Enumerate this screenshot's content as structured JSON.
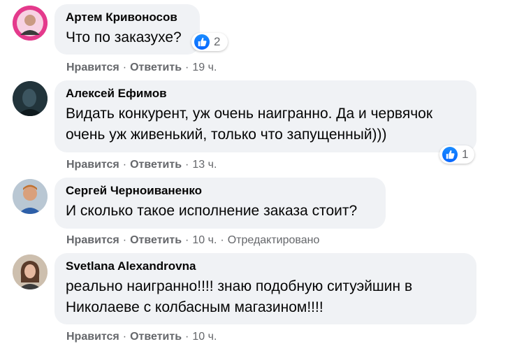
{
  "comments": [
    {
      "author": "Артем Кривоносов",
      "text": "Что по заказухе?",
      "reactions": "2",
      "like": "Нравится",
      "reply": "Ответить",
      "time": "19 ч.",
      "edited": ""
    },
    {
      "author": "Алексей Ефимов",
      "text": "Видать конкурент, уж очень наигранно. Да и червячок очень уж живенький, только что запущенный)))",
      "reactions": "1",
      "like": "Нравится",
      "reply": "Ответить",
      "time": "13 ч.",
      "edited": ""
    },
    {
      "author": "Сергей Черноиваненко",
      "text": "И сколько такое исполнение заказа стоит?",
      "reactions": "",
      "like": "Нравится",
      "reply": "Ответить",
      "time": "10 ч.",
      "edited": "Отредактировано"
    },
    {
      "author": "Svetlana Alexandrovna",
      "text": "реально наигранно!!!! знаю подобную ситуэйшин в Николаеве с колбасным магазином!!!!",
      "reactions": "",
      "like": "Нравится",
      "reply": "Ответить",
      "time": "10 ч.",
      "edited": ""
    }
  ],
  "separator": "·",
  "colors": {
    "bubble": "#f0f2f5",
    "meta_text": "#65676b",
    "like_blue": "#0866ff"
  },
  "icons": {
    "reaction": "like-thumbs-up-icon"
  }
}
